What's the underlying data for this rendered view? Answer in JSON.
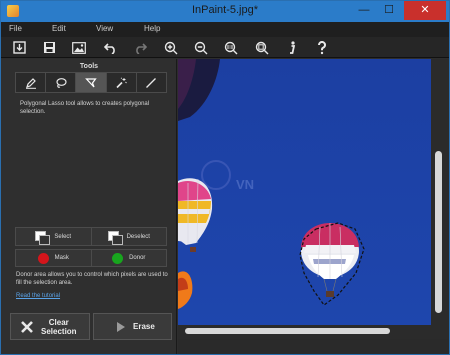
{
  "window": {
    "title": "InPaint-5.jpg*",
    "min_glyph": "—",
    "max_glyph": "☐",
    "close_glyph": "✕"
  },
  "menu": {
    "items": [
      "File",
      "Edit",
      "View",
      "Help"
    ]
  },
  "toolbar": {
    "buttons": [
      "open-icon",
      "save-icon",
      "image-icon",
      "undo-icon",
      "redo-icon",
      "zoom-in-icon",
      "zoom-out-icon",
      "actual-size-icon",
      "fit-icon",
      "info-icon",
      "help-icon"
    ]
  },
  "tools_panel": {
    "title": "Tools",
    "tools": [
      "marker-icon",
      "lasso-icon",
      "polygonal-lasso-icon",
      "magic-wand-icon",
      "line-icon"
    ],
    "active_tool": "polygonal-lasso-icon",
    "description": "Polygonal Lasso tool allows to creates polygonal selection.",
    "select_label": "Select",
    "deselect_label": "Deselect",
    "mask_label": "Mask",
    "donor_label": "Donor",
    "mask_color": "#d4151b",
    "donor_color": "#18a51e",
    "donor_description": "Donor area allows you to control which pixels are used to fill the selection area.",
    "tutorial_link": "Read the tutorial",
    "clear_label_line1": "Clear",
    "clear_label_line2": "Selection",
    "erase_label": "Erase"
  },
  "canvas": {
    "watermark": "VN",
    "sky_color": "#1a3ea0"
  },
  "colors": {
    "titlebar": "#2b7cc9",
    "close": "#c9302c",
    "link": "#5aa3e8"
  }
}
